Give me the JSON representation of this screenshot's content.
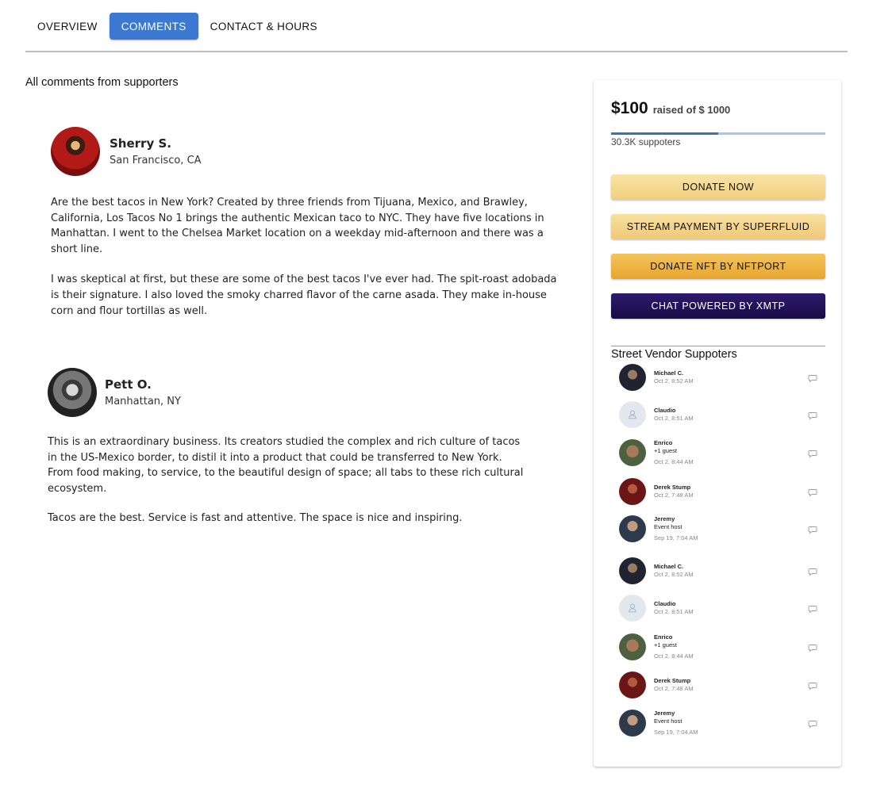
{
  "tabs": [
    {
      "label": "OVERVIEW"
    },
    {
      "label": "COMMENTS"
    },
    {
      "label": "CONTACT & HOURS"
    }
  ],
  "section_title": "All comments from supporters",
  "comments": [
    {
      "name": "Sherry S.",
      "location": "San Francisco, CA",
      "paragraphs": [
        "Are the best tacos in New York? Created by three friends from Tijuana, Mexico, and Brawley, California, Los Tacos No 1 brings the authentic Mexican taco to NYC. They have five locations in Manhattan. I went to the Chelsea Market location on a weekday mid-afternoon and there was a short line.",
        "I was skeptical at first, but these are some of the best tacos I've ever had. The spit-roast adobada is their signature. I also loved the smoky charred flavor of the carne asada. They make in-house corn and flour tortillas as well."
      ]
    },
    {
      "name": "Pett O.",
      "location": "Manhattan, NY",
      "paragraphs": [
        "This is an extraordinary business. Its creators studied the complex and rich culture of tacos in the US-Mexico border, to distil it into a product that could be transferred to New York. From food making, to service, to the beautiful design of space; all tabs to these rich cultural ecosystem.",
        "Tacos are the best. Service is fast and attentive. The space is nice and inspiring."
      ]
    }
  ],
  "donation": {
    "raised_amount": "$100",
    "raised_label": "raised of $ 1000",
    "progress_fraction": 0.5,
    "supporters": "30.3K suppoters",
    "buttons": {
      "donate": "DONATE NOW",
      "stream": "STREAM PAYMENT BY SUPERFLUID",
      "nft": "DONATE NFT BY NFTPORT",
      "chat": "CHAT POWERED BY XMTP"
    },
    "supporters_title": "Street Vendor Suppoters",
    "supporter_list": [
      {
        "name": "Michael C.",
        "note": "",
        "time": "Oct 2, 8:52 AM"
      },
      {
        "name": "Claudio",
        "note": "",
        "time": "Oct 2, 8:51 AM"
      },
      {
        "name": "Enrico",
        "note": "+1 guest",
        "time": "Oct 2, 8:44 AM"
      },
      {
        "name": "Derek Stump",
        "note": "",
        "time": "Oct 2, 7:48 AM"
      },
      {
        "name": "Jeremy",
        "note": "Event host",
        "time": "Sep 19, 7:04 AM"
      },
      {
        "name": "Michael C.",
        "note": "",
        "time": "Oct 2, 8:52 AM"
      },
      {
        "name": "Claudio",
        "note": "",
        "time": "Oct 2, 8:51 AM"
      },
      {
        "name": "Enrico",
        "note": "+1 guest",
        "time": "Oct 2, 8:44 AM"
      },
      {
        "name": "Derek Stump",
        "note": "",
        "time": "Oct 2, 7:48 AM"
      },
      {
        "name": "Jeremy",
        "note": "Event host",
        "time": "Sep 19, 7:04 AM"
      }
    ]
  }
}
